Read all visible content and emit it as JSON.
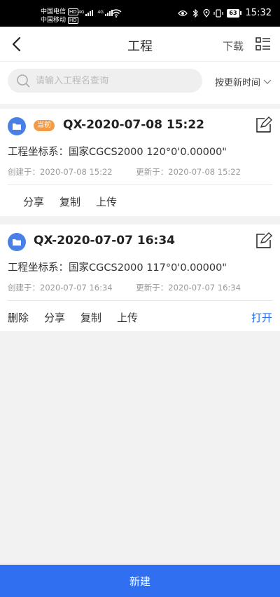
{
  "status_bar": {
    "carrier1": "中国电信",
    "carrier2": "中国移动",
    "hd": "HD",
    "net1": "4G",
    "net2": "4G",
    "battery": "63",
    "time": "15:32"
  },
  "header": {
    "title": "工程",
    "download_label": "下载"
  },
  "search": {
    "placeholder": "请输入工程名查询",
    "sort_label": "按更新时间"
  },
  "projects": [
    {
      "badge": "当前",
      "name": "QX-2020-07-08 15:22",
      "coord": "工程坐标系：国家CGCS2000  120°0'0.00000\"",
      "created": "创建于：2020-07-08 15:22",
      "updated": "更新于：2020-07-08 15:22",
      "actions": [
        "分享",
        "复制",
        "上传"
      ]
    },
    {
      "name": "QX-2020-07-07 16:34",
      "coord": "工程坐标系：国家CGCS2000  117°0'0.00000\"",
      "created": "创建于：2020-07-07 16:34",
      "updated": "更新于：2020-07-07 16:34",
      "actions": [
        "删除",
        "分享",
        "复制",
        "上传"
      ],
      "open_label": "打开"
    }
  ],
  "footer": {
    "new_label": "新建"
  },
  "colors": {
    "accent": "#2f6ff0",
    "badge": "#f39a46",
    "folder": "#4a7fe6"
  }
}
